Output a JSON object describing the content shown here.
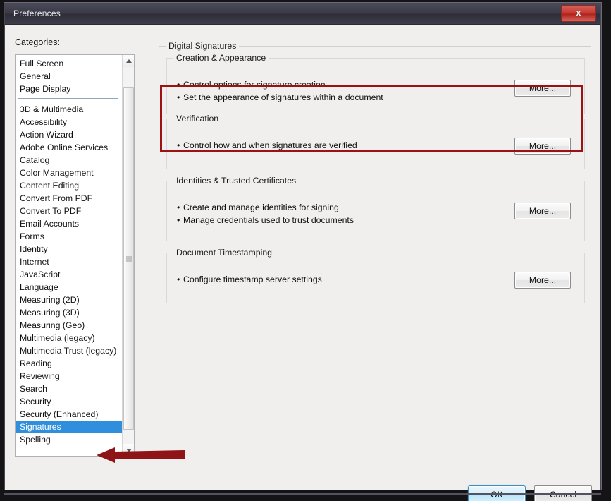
{
  "window": {
    "title": "Preferences",
    "close_label": "x",
    "close_icon": "close-x-icon"
  },
  "left": {
    "categories_label": "Categories:",
    "items": [
      {
        "label": "Full Screen",
        "selected": false,
        "separator_after": false
      },
      {
        "label": "General",
        "selected": false,
        "separator_after": false
      },
      {
        "label": "Page Display",
        "selected": false,
        "separator_after": true
      },
      {
        "label": "3D & Multimedia",
        "selected": false,
        "separator_after": false
      },
      {
        "label": "Accessibility",
        "selected": false,
        "separator_after": false
      },
      {
        "label": "Action Wizard",
        "selected": false,
        "separator_after": false
      },
      {
        "label": "Adobe Online Services",
        "selected": false,
        "separator_after": false
      },
      {
        "label": "Catalog",
        "selected": false,
        "separator_after": false
      },
      {
        "label": "Color Management",
        "selected": false,
        "separator_after": false
      },
      {
        "label": "Content Editing",
        "selected": false,
        "separator_after": false
      },
      {
        "label": "Convert From PDF",
        "selected": false,
        "separator_after": false
      },
      {
        "label": "Convert To PDF",
        "selected": false,
        "separator_after": false
      },
      {
        "label": "Email Accounts",
        "selected": false,
        "separator_after": false
      },
      {
        "label": "Forms",
        "selected": false,
        "separator_after": false
      },
      {
        "label": "Identity",
        "selected": false,
        "separator_after": false
      },
      {
        "label": "Internet",
        "selected": false,
        "separator_after": false
      },
      {
        "label": "JavaScript",
        "selected": false,
        "separator_after": false
      },
      {
        "label": "Language",
        "selected": false,
        "separator_after": false
      },
      {
        "label": "Measuring (2D)",
        "selected": false,
        "separator_after": false
      },
      {
        "label": "Measuring (3D)",
        "selected": false,
        "separator_after": false
      },
      {
        "label": "Measuring (Geo)",
        "selected": false,
        "separator_after": false
      },
      {
        "label": "Multimedia (legacy)",
        "selected": false,
        "separator_after": false
      },
      {
        "label": "Multimedia Trust (legacy)",
        "selected": false,
        "separator_after": false
      },
      {
        "label": "Reading",
        "selected": false,
        "separator_after": false
      },
      {
        "label": "Reviewing",
        "selected": false,
        "separator_after": false
      },
      {
        "label": "Search",
        "selected": false,
        "separator_after": false
      },
      {
        "label": "Security",
        "selected": false,
        "separator_after": false
      },
      {
        "label": "Security (Enhanced)",
        "selected": false,
        "separator_after": false
      },
      {
        "label": "Signatures",
        "selected": true,
        "separator_after": false
      },
      {
        "label": "Spelling",
        "selected": false,
        "separator_after": false
      }
    ],
    "scrollbar": {
      "up_arrow_icon": "scroll-up-arrow-icon",
      "down_arrow_icon": "scroll-down-arrow-icon",
      "thumb_grip_icon": "scrollbar-grip-icon"
    }
  },
  "right": {
    "group_title": "Digital Signatures",
    "sections": [
      {
        "title": "Creation & Appearance",
        "bullets": [
          "Control options for signature creation",
          "Set the appearance of signatures within a document"
        ],
        "button": "More..."
      },
      {
        "title": "Verification",
        "bullets": [
          "Control how and when signatures are verified"
        ],
        "button": "More..."
      },
      {
        "title": "Identities & Trusted Certificates",
        "bullets": [
          "Create and manage identities for signing",
          "Manage credentials used to trust documents"
        ],
        "button": "More..."
      },
      {
        "title": "Document Timestamping",
        "bullets": [
          "Configure timestamp server settings"
        ],
        "button": "More..."
      }
    ]
  },
  "footer": {
    "ok_label": "OK",
    "cancel_label": "Cancel"
  },
  "annotations": {
    "highlight_color": "#9c1212",
    "arrow_color": "#8e1418",
    "highlight_target": "Creation & Appearance",
    "arrow_target": "Signatures"
  }
}
